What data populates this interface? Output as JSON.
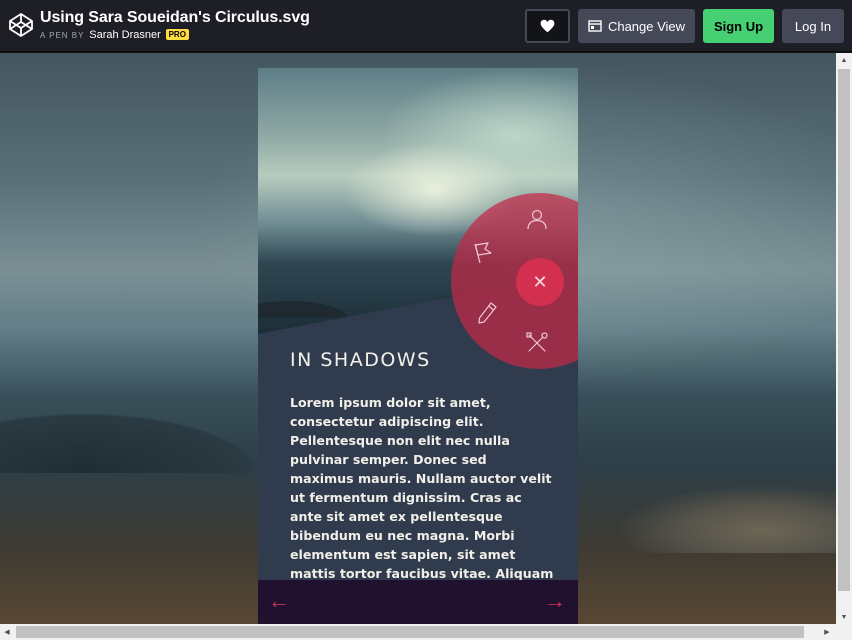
{
  "header": {
    "title": "Using Sara Soueidan's Circulus.svg",
    "byline_prefix": "A PEN BY",
    "author": "Sarah Drasner",
    "badge": "PRO",
    "buttons": {
      "heart_icon": "heart-icon",
      "change_view": "Change View",
      "sign_up": "Sign Up",
      "log_in": "Log In"
    }
  },
  "card": {
    "heading": "IN SHADOWS",
    "body": "Lorem ipsum dolor sit amet, consectetur adipiscing elit. Pellentesque non elit nec nulla pulvinar semper. Donec sed maximus mauris. Nullam auctor velit ut fermentum dignissim. Cras ac ante sit amet ex pellentesque bibendum eu nec magna. Morbi elementum est sapien, sit amet mattis tortor faucibus vitae. Aliquam ornare mi nisi, sit amet vestibulum nisi",
    "prev_arrow": "←",
    "next_arrow": "→",
    "close_symbol": "✕",
    "menu_icons": [
      "user-icon",
      "flag-icon",
      "pencil-icon",
      "tools-icon"
    ]
  },
  "colors": {
    "accent_green": "#47cf73",
    "badge_yellow": "#ffdd40",
    "circle_red": "#c42846",
    "footer_purple": "#22112e",
    "card_slate": "#303c4e"
  }
}
